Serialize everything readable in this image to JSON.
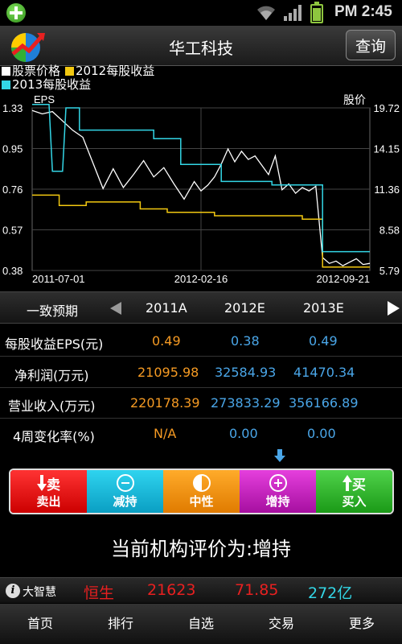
{
  "status_bar": {
    "time": "PM 2:45"
  },
  "header": {
    "title": "华工科技",
    "query_label": "查询"
  },
  "legend": [
    {
      "label": "股票价格",
      "color": "#ffffff"
    },
    {
      "label": "2012每股收益",
      "color": "#f2c811"
    },
    {
      "label": "2013每股收益",
      "color": "#33d6e6"
    }
  ],
  "chart_data": {
    "type": "line",
    "ylabel": "EPS",
    "y2label": "股价",
    "ylim": [
      0.38,
      1.33
    ],
    "y2lim": [
      5.79,
      19.72
    ],
    "y_ticks": [
      "1.33",
      "0.95",
      "0.76",
      "0.57",
      "0.38"
    ],
    "y2_ticks": [
      "19.72",
      "14.15",
      "11.36",
      "8.58",
      "5.79"
    ],
    "x_ticks": [
      "2011-07-01",
      "2012-02-16",
      "2012-09-21"
    ],
    "grid": true,
    "series": [
      {
        "name": "股票价格",
        "axis": "right",
        "color": "#ffffff",
        "x": [
          0,
          0.03,
          0.06,
          0.09,
          0.12,
          0.15,
          0.18,
          0.21,
          0.24,
          0.27,
          0.3,
          0.33,
          0.36,
          0.39,
          0.42,
          0.45,
          0.48,
          0.5,
          0.52,
          0.54,
          0.56,
          0.58,
          0.6,
          0.62,
          0.64,
          0.66,
          0.68,
          0.7,
          0.72,
          0.74,
          0.76,
          0.78,
          0.8,
          0.82,
          0.84,
          0.86,
          0.88,
          0.9,
          0.92,
          0.94,
          0.96,
          0.98,
          1.0
        ],
        "y": [
          19.5,
          19.2,
          19.4,
          18.6,
          17.8,
          17.2,
          15.0,
          12.8,
          14.5,
          12.9,
          14.0,
          15.2,
          13.8,
          14.6,
          13.2,
          11.9,
          13.4,
          12.6,
          13.1,
          13.8,
          14.9,
          16.2,
          15.1,
          16.0,
          15.3,
          15.6,
          14.8,
          14.0,
          15.6,
          12.7,
          13.2,
          12.4,
          12.9,
          12.6,
          13.0,
          6.9,
          6.4,
          6.6,
          6.2,
          6.5,
          6.8,
          6.3,
          6.4
        ]
      },
      {
        "name": "2012每股收益",
        "axis": "left",
        "color": "#f2c811",
        "x": [
          0,
          0.08,
          0.08,
          0.16,
          0.16,
          0.32,
          0.32,
          0.4,
          0.4,
          0.54,
          0.54,
          0.8,
          0.8,
          0.86,
          0.86,
          1.0
        ],
        "y": [
          0.82,
          0.82,
          0.76,
          0.76,
          0.78,
          0.78,
          0.74,
          0.74,
          0.72,
          0.72,
          0.7,
          0.7,
          0.68,
          0.68,
          0.4,
          0.4
        ]
      },
      {
        "name": "2013每股收益",
        "axis": "left",
        "color": "#33d6e6",
        "x": [
          0,
          0.05,
          0.06,
          0.09,
          0.1,
          0.14,
          0.14,
          0.36,
          0.36,
          0.44,
          0.44,
          0.56,
          0.56,
          0.71,
          0.71,
          0.86,
          0.86,
          1.0
        ],
        "y": [
          1.35,
          1.35,
          0.96,
          0.96,
          1.33,
          1.33,
          1.2,
          1.2,
          1.15,
          1.15,
          1.0,
          1.0,
          0.9,
          0.9,
          0.88,
          0.88,
          0.49,
          0.49
        ]
      }
    ]
  },
  "forecast": {
    "title": "一致预期",
    "columns": [
      "2011A",
      "2012E",
      "2013E"
    ],
    "rows": [
      {
        "label": "每股收益EPS(元)",
        "values": [
          "0.49",
          "0.38",
          "0.49"
        ]
      },
      {
        "label": "净利润(万元)",
        "values": [
          "21095.98",
          "32584.93",
          "41470.34"
        ]
      },
      {
        "label": "营业收入(万元)",
        "values": [
          "220178.39",
          "273833.29",
          "356166.89"
        ]
      },
      {
        "label": "4周变化率(%)",
        "values": [
          "N/A",
          "0.00",
          "0.00"
        ]
      }
    ]
  },
  "rating_buttons": [
    {
      "id": "sell",
      "label": "卖出",
      "icon_text": "卖",
      "color": "#e82020"
    },
    {
      "id": "reduce",
      "label": "减持",
      "icon_text": "−",
      "color": "#17b8d8"
    },
    {
      "id": "neutral",
      "label": "中性",
      "icon_text": "",
      "color": "#f29412"
    },
    {
      "id": "increase",
      "label": "增持",
      "icon_text": "+",
      "color": "#c823c1"
    },
    {
      "id": "buy",
      "label": "买入",
      "icon_text": "买",
      "color": "#2fb52a"
    }
  ],
  "rating_summary": "当前机构评价为:增持",
  "ticker": {
    "brand": "大智慧",
    "index_name": "恒生",
    "index_value": "21623",
    "change": "71.85",
    "volume": "272亿"
  },
  "bottom_nav": [
    "首页",
    "排行",
    "自选",
    "交易",
    "更多"
  ]
}
